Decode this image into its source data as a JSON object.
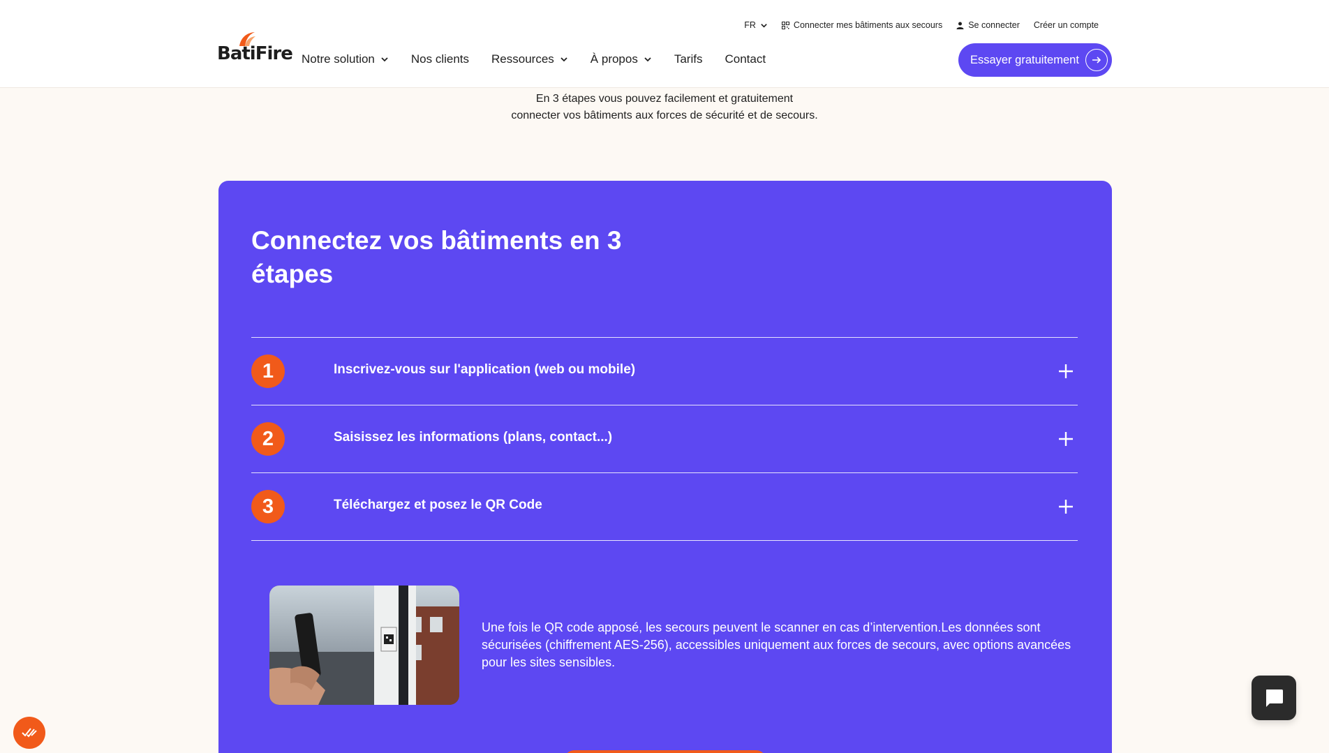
{
  "brand": {
    "name": "BatiFire",
    "logo_text": "BatiFire",
    "accent_color": "#5d48f2",
    "orange_color": "#f15a1a"
  },
  "utility_nav": {
    "language": "FR",
    "connect_link": "Connecter mes bâtiments aux secours",
    "login": "Se connecter",
    "signup": "Créer un compte"
  },
  "main_nav": {
    "items": [
      {
        "label": "Notre solution",
        "dropdown": true
      },
      {
        "label": "Nos clients",
        "dropdown": false
      },
      {
        "label": "Ressources",
        "dropdown": true
      },
      {
        "label": "À propos",
        "dropdown": true
      },
      {
        "label": "Tarifs",
        "dropdown": false
      },
      {
        "label": "Contact",
        "dropdown": false
      }
    ],
    "cta_label": "Essayer gratuitement"
  },
  "intro": {
    "line1": "En 3 étapes vous pouvez facilement et gratuitement",
    "line2": "connecter vos bâtiments aux forces de sécurité et de secours."
  },
  "section": {
    "title": "Connectez vos bâtiments en 3 étapes",
    "steps": [
      {
        "number": "1",
        "label": "Inscrivez-vous sur l'application (web ou mobile)"
      },
      {
        "number": "2",
        "label": "Saisissez les informations (plans, contact...)"
      },
      {
        "number": "3",
        "label": "Téléchargez et posez le QR Code"
      }
    ],
    "description": "Une fois le QR code apposé, les secours peuvent le scanner en cas d’intervention.Les données sont sécurisées (chiffrement AES-256), accessibles uniquement aux forces de secours, avec options avancées pour les sites sensibles."
  },
  "icons": {
    "language_chevron": "chevron-down-icon",
    "qr": "qr-code-icon",
    "user": "user-icon",
    "cta_arrow": "arrow-right-circle-icon",
    "step_toggle": "plus-icon",
    "cookie": "cookie-consent-icon",
    "chat": "chat-icon"
  }
}
